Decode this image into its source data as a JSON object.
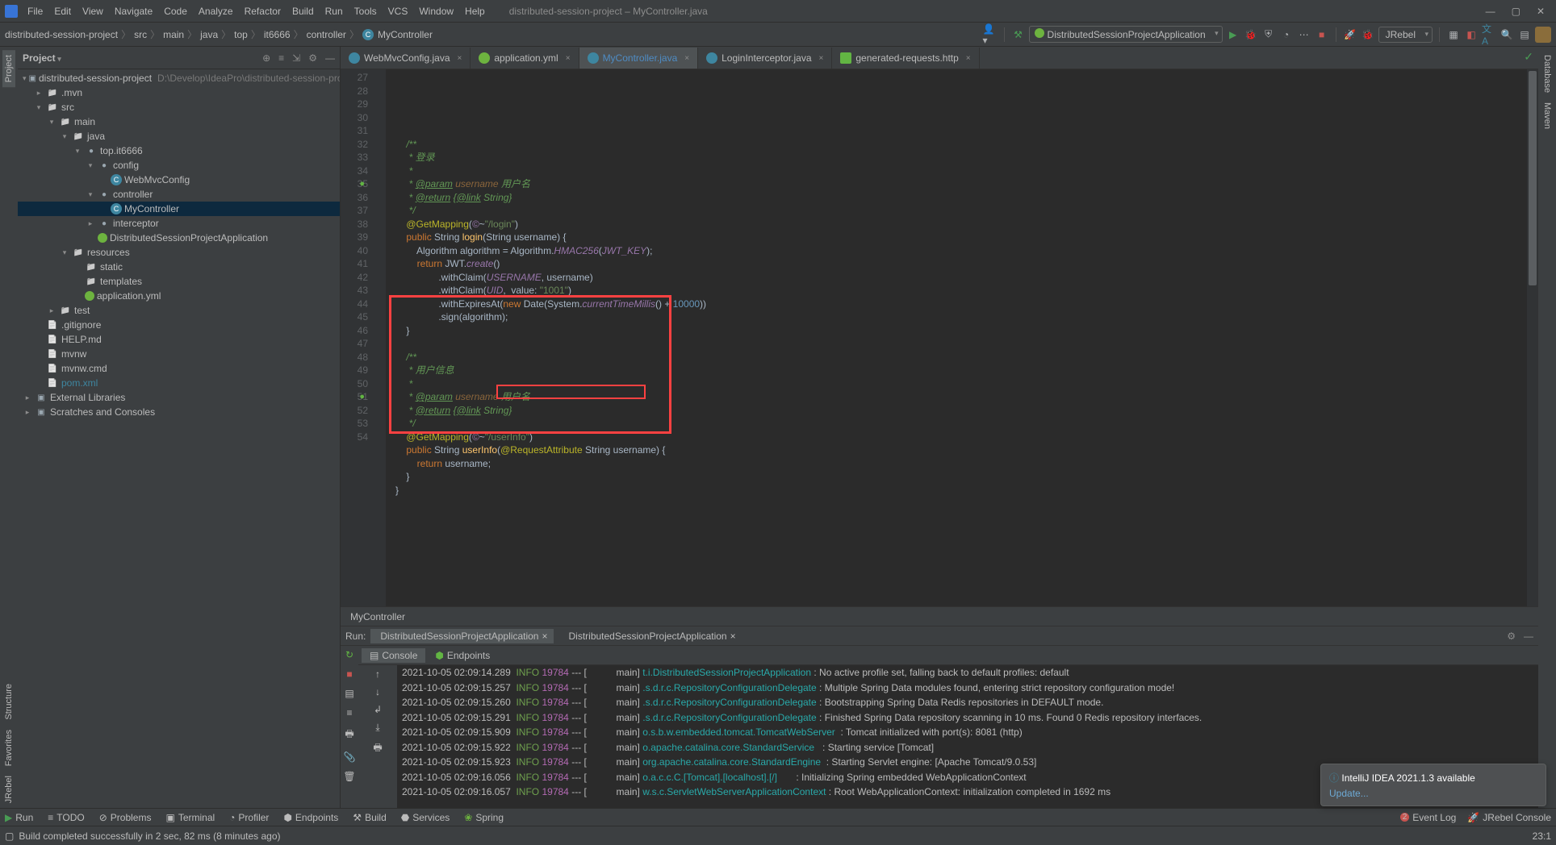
{
  "window": {
    "title": "distributed-session-project – MyController.java",
    "menus": [
      "File",
      "Edit",
      "View",
      "Navigate",
      "Code",
      "Analyze",
      "Refactor",
      "Build",
      "Run",
      "Tools",
      "VCS",
      "Window",
      "Help"
    ]
  },
  "breadcrumbs": [
    "distributed-session-project",
    "src",
    "main",
    "java",
    "top",
    "it6666",
    "controller",
    "MyController"
  ],
  "run_config": "DistributedSessionProjectApplication",
  "jrebel_btn": "JRebel",
  "project_panel": {
    "title": "Project"
  },
  "tree": [
    {
      "indent": 0,
      "arrow": "open",
      "icon": "module",
      "name": "distributed-session-project",
      "path": "D:\\Develop\\IdeaPro\\distributed-session-project"
    },
    {
      "indent": 1,
      "arrow": "closed",
      "icon": "folder",
      "name": ".mvn"
    },
    {
      "indent": 1,
      "arrow": "open",
      "icon": "folder",
      "name": "src"
    },
    {
      "indent": 2,
      "arrow": "open",
      "icon": "folder",
      "name": "main"
    },
    {
      "indent": 3,
      "arrow": "open",
      "icon": "folder",
      "name": "java"
    },
    {
      "indent": 4,
      "arrow": "open",
      "icon": "pkg",
      "name": "top.it6666"
    },
    {
      "indent": 5,
      "arrow": "open",
      "icon": "pkg",
      "name": "config"
    },
    {
      "indent": 6,
      "arrow": "none",
      "icon": "class",
      "name": "WebMvcConfig"
    },
    {
      "indent": 5,
      "arrow": "open",
      "icon": "pkg",
      "name": "controller"
    },
    {
      "indent": 6,
      "arrow": "none",
      "icon": "class",
      "name": "MyController",
      "sel": true
    },
    {
      "indent": 5,
      "arrow": "closed",
      "icon": "pkg",
      "name": "interceptor"
    },
    {
      "indent": 5,
      "arrow": "none",
      "icon": "spring",
      "name": "DistributedSessionProjectApplication"
    },
    {
      "indent": 3,
      "arrow": "open",
      "icon": "folder",
      "name": "resources"
    },
    {
      "indent": 4,
      "arrow": "none",
      "icon": "folder",
      "name": "static"
    },
    {
      "indent": 4,
      "arrow": "none",
      "icon": "folder",
      "name": "templates"
    },
    {
      "indent": 4,
      "arrow": "none",
      "icon": "spring",
      "name": "application.yml"
    },
    {
      "indent": 2,
      "arrow": "closed",
      "icon": "folder",
      "name": "test"
    },
    {
      "indent": 1,
      "arrow": "none",
      "icon": "file",
      "name": ".gitignore"
    },
    {
      "indent": 1,
      "arrow": "none",
      "icon": "file",
      "name": "HELP.md"
    },
    {
      "indent": 1,
      "arrow": "none",
      "icon": "file",
      "name": "mvnw"
    },
    {
      "indent": 1,
      "arrow": "none",
      "icon": "file",
      "name": "mvnw.cmd"
    },
    {
      "indent": 1,
      "arrow": "none",
      "icon": "file",
      "name": "pom.xml",
      "color": "#3e86a0"
    },
    {
      "indent": 0,
      "arrow": "closed",
      "icon": "module",
      "name": "External Libraries"
    },
    {
      "indent": 0,
      "arrow": "closed",
      "icon": "module",
      "name": "Scratches and Consoles"
    }
  ],
  "tabs": [
    {
      "icon": "class-fi",
      "label": "WebMvcConfig.java"
    },
    {
      "icon": "spring-fi",
      "label": "application.yml"
    },
    {
      "icon": "class-fi",
      "label": "MyController.java",
      "active": true,
      "mod": true
    },
    {
      "icon": "class-fi",
      "label": "LoginInterceptor.java"
    },
    {
      "icon": "http-fi",
      "label": "generated-requests.http"
    }
  ],
  "code_lines": [
    {
      "n": 27,
      "html": ""
    },
    {
      "n": 28,
      "html": "    <span class='doc'>/**</span>"
    },
    {
      "n": 29,
      "html": "    <span class='doc'> * 登录</span>"
    },
    {
      "n": 30,
      "html": "    <span class='doc'> *</span>"
    },
    {
      "n": 31,
      "html": "    <span class='doc'> * <span class='doctag'>@param</span> <span class='docparm'>username</span> 用户名</span>"
    },
    {
      "n": 32,
      "html": "    <span class='doc'> * <span class='doctag'>@return</span> {<span class='doctag'>@link</span> String}</span>"
    },
    {
      "n": 33,
      "html": "    <span class='doc'> */</span>"
    },
    {
      "n": 34,
      "html": "    <span class='ann'>@GetMapping</span>(<span class='fld'>©</span>~<span class='str'>\"/login\"</span>)"
    },
    {
      "n": 35,
      "html": "    <span class='kw'>public</span> String <span class='mtd'>login</span>(String username) {",
      "run": true
    },
    {
      "n": 36,
      "html": "        Algorithm algorithm = Algorithm.<span class='fld'>HMAC256</span>(<span class='fld'>JWT_KEY</span>);"
    },
    {
      "n": 37,
      "html": "        <span class='kw'>return</span> JWT.<span class='fld'>create</span>()"
    },
    {
      "n": 38,
      "html": "                .withClaim(<span class='fld'>USERNAME</span>, username)"
    },
    {
      "n": 39,
      "html": "                .withClaim(<span class='fld'>UID</span>,  value: <span class='str'>\"1001\"</span>)"
    },
    {
      "n": 40,
      "html": "                .withExpiresAt(<span class='kw'>new</span> Date(System.<span class='fld'>currentTimeMillis</span>() + <span class='num'>10000</span>))"
    },
    {
      "n": 41,
      "html": "                .sign(algorithm);"
    },
    {
      "n": 42,
      "html": "    }"
    },
    {
      "n": 43,
      "html": ""
    },
    {
      "n": 44,
      "html": "    <span class='doc'>/**</span>"
    },
    {
      "n": 45,
      "html": "    <span class='doc'> * 用户信息</span>"
    },
    {
      "n": 46,
      "html": "    <span class='doc'> *</span>"
    },
    {
      "n": 47,
      "html": "    <span class='doc'> * <span class='doctag'>@param</span> <span class='docparm'>username</span> 用户名</span>"
    },
    {
      "n": 48,
      "html": "    <span class='doc'> * <span class='doctag'>@return</span> {<span class='doctag'>@link</span> String}</span>"
    },
    {
      "n": 49,
      "html": "    <span class='doc'> */</span>"
    },
    {
      "n": 50,
      "html": "    <span class='ann'>@GetMapping</span>(<span class='fld'>©</span>~<span class='str'>\"/userInfo\"</span>)"
    },
    {
      "n": 51,
      "html": "    <span class='kw'>public</span> String <span class='mtd'>userInfo</span>(<span class='ann'>@RequestAttribute</span> String username) {",
      "run": true
    },
    {
      "n": 52,
      "html": "        <span class='kw'>return</span> username;"
    },
    {
      "n": 53,
      "html": "    }"
    },
    {
      "n": 54,
      "html": "}"
    }
  ],
  "editor_crumb": "MyController",
  "run_panel": {
    "label": "Run:",
    "tabs": [
      "DistributedSessionProjectApplication",
      "DistributedSessionProjectApplication"
    ],
    "sub_tabs": [
      "Console",
      "Endpoints"
    ]
  },
  "logs": [
    {
      "ts": "2021-10-05 02:09:14.289",
      "lvl": "INFO",
      "pid": "19784",
      "sep": "--- [",
      "thr": "main]",
      "lg": "t.i.DistributedSessionProjectApplication",
      "msg": ": No active profile set, falling back to default profiles: default"
    },
    {
      "ts": "2021-10-05 02:09:15.257",
      "lvl": "INFO",
      "pid": "19784",
      "sep": "--- [",
      "thr": "main]",
      "lg": ".s.d.r.c.RepositoryConfigurationDelegate",
      "msg": ": Multiple Spring Data modules found, entering strict repository configuration mode!"
    },
    {
      "ts": "2021-10-05 02:09:15.260",
      "lvl": "INFO",
      "pid": "19784",
      "sep": "--- [",
      "thr": "main]",
      "lg": ".s.d.r.c.RepositoryConfigurationDelegate",
      "msg": ": Bootstrapping Spring Data Redis repositories in DEFAULT mode."
    },
    {
      "ts": "2021-10-05 02:09:15.291",
      "lvl": "INFO",
      "pid": "19784",
      "sep": "--- [",
      "thr": "main]",
      "lg": ".s.d.r.c.RepositoryConfigurationDelegate",
      "msg": ": Finished Spring Data repository scanning in 10 ms. Found 0 Redis repository interfaces."
    },
    {
      "ts": "2021-10-05 02:09:15.909",
      "lvl": "INFO",
      "pid": "19784",
      "sep": "--- [",
      "thr": "main]",
      "lg": "o.s.b.w.embedded.tomcat.TomcatWebServer ",
      "msg": ": Tomcat initialized with port(s): 8081 (http)"
    },
    {
      "ts": "2021-10-05 02:09:15.922",
      "lvl": "INFO",
      "pid": "19784",
      "sep": "--- [",
      "thr": "main]",
      "lg": "o.apache.catalina.core.StandardService  ",
      "msg": ": Starting service [Tomcat]"
    },
    {
      "ts": "2021-10-05 02:09:15.923",
      "lvl": "INFO",
      "pid": "19784",
      "sep": "--- [",
      "thr": "main]",
      "lg": "org.apache.catalina.core.StandardEngine ",
      "msg": ": Starting Servlet engine: [Apache Tomcat/9.0.53]"
    },
    {
      "ts": "2021-10-05 02:09:16.056",
      "lvl": "INFO",
      "pid": "19784",
      "sep": "--- [",
      "thr": "main]",
      "lg": "o.a.c.c.C.[Tomcat].[localhost].[/]      ",
      "msg": ": Initializing Spring embedded WebApplicationContext"
    },
    {
      "ts": "2021-10-05 02:09:16.057",
      "lvl": "INFO",
      "pid": "19784",
      "sep": "--- [",
      "thr": "main]",
      "lg": "w.s.c.ServletWebServerApplicationContext",
      "msg": ": Root WebApplicationContext: initialization completed in 1692 ms"
    }
  ],
  "notification": {
    "title": "IntelliJ IDEA 2021.1.3 available",
    "link": "Update..."
  },
  "tool_strip": [
    "Run",
    "TODO",
    "Problems",
    "Terminal",
    "Profiler",
    "Endpoints",
    "Build",
    "Services",
    "Spring"
  ],
  "tool_strip_right": [
    "Event Log",
    "JRebel Console"
  ],
  "status": {
    "msg": "Build completed successfully in 2 sec, 82 ms (8 minutes ago)",
    "pos": "23:1",
    "problems": "2"
  },
  "side_tabs_left": [
    "Project",
    "Structure",
    "Favorites",
    "JRebel"
  ],
  "side_tabs_right": [
    "Database",
    "Maven"
  ]
}
